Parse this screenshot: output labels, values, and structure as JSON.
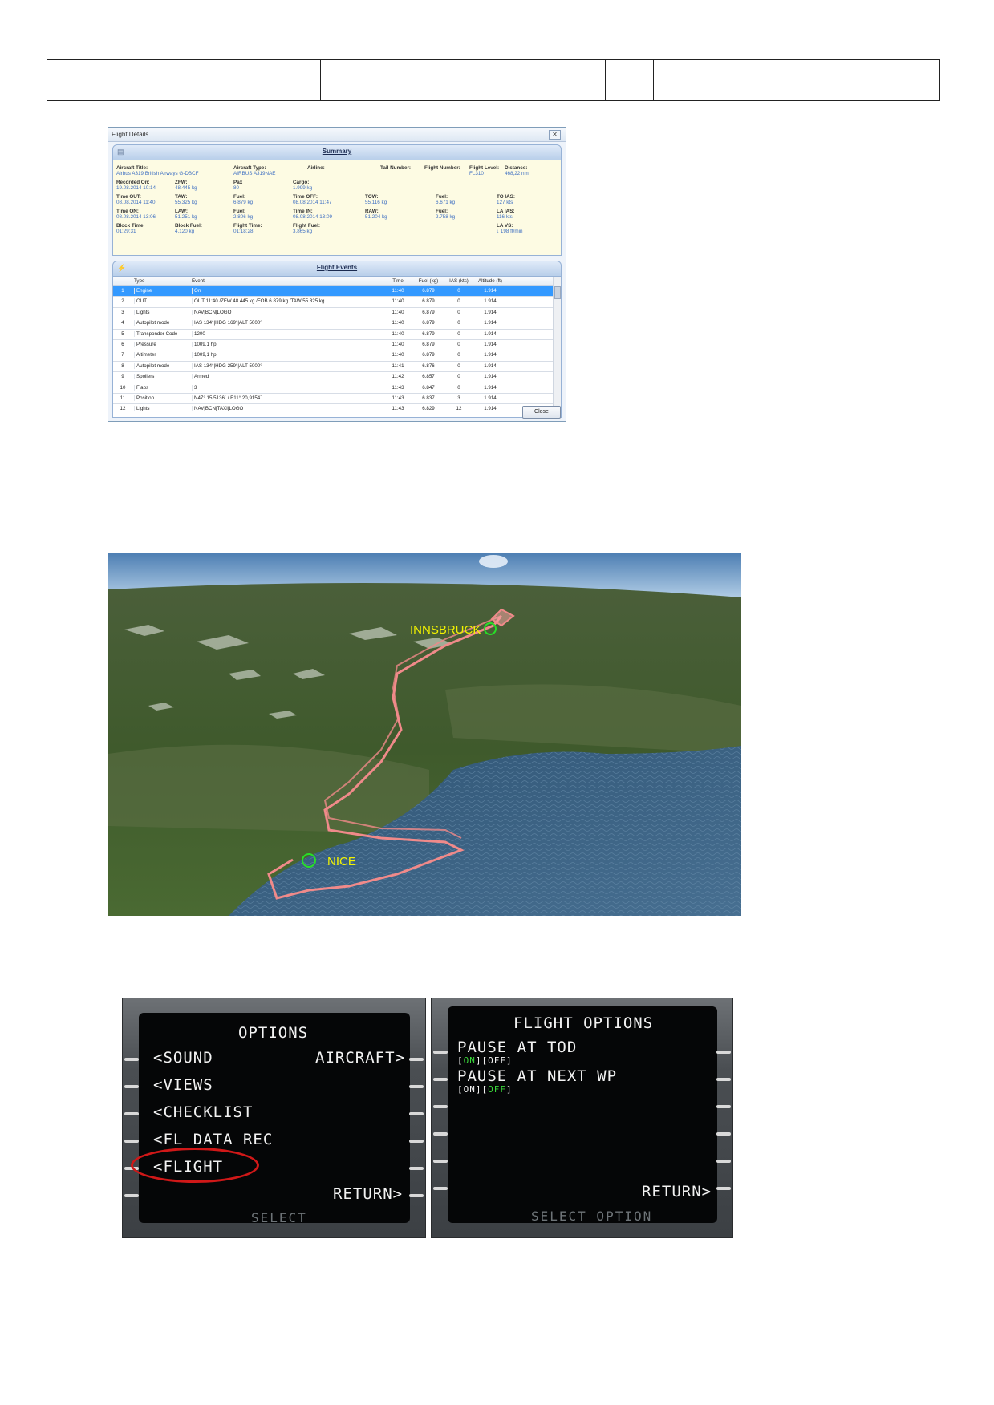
{
  "flight_details": {
    "window_title": "Flight Details",
    "summary_title": "Summary",
    "events_title": "Flight Events",
    "close_label": "Close",
    "summary": [
      {
        "label": "Aircraft Title:",
        "value": "Airbus A319 British Airways G-DBCF"
      },
      {
        "label": "Aircraft Type:",
        "value": "AIRBUS A319NAE"
      },
      {
        "label": "Airline:",
        "value": ""
      },
      {
        "label": "Tail Number:",
        "value": ""
      },
      {
        "label": "Flight Number:",
        "value": ""
      },
      {
        "label": "Flight Level:",
        "value": "FL310"
      },
      {
        "label": "Distance:",
        "value": "468,22 nm"
      },
      {
        "label": "Recorded On:",
        "value": "19.08.2014 10:14"
      },
      {
        "label": "ZFW:",
        "value": "48.445 kg"
      },
      {
        "label": "Pax",
        "value": "80"
      },
      {
        "label": "Cargo:",
        "value": "1.999 kg"
      },
      {
        "label": "Time OUT:",
        "value": "08.08.2014 11:40"
      },
      {
        "label": "TAW:",
        "value": "55.325 kg"
      },
      {
        "label": "Fuel:",
        "value": "6.879 kg"
      },
      {
        "label": "Time OFF:",
        "value": "08.08.2014 11:47"
      },
      {
        "label": "TOW:",
        "value": "55.116 kg"
      },
      {
        "label": "Fuel:",
        "value": "6.671 kg"
      },
      {
        "label": "TO IAS:",
        "value": "127 kts"
      },
      {
        "label": "Time ON:",
        "value": "08.08.2014 13:06"
      },
      {
        "label": "LAW:",
        "value": "51.251 kg"
      },
      {
        "label": "Fuel:",
        "value": "2.806 kg"
      },
      {
        "label": "Time IN:",
        "value": "08.08.2014 13:09"
      },
      {
        "label": "RAW:",
        "value": "51.204 kg"
      },
      {
        "label": "Fuel:",
        "value": "2.758 kg"
      },
      {
        "label": "LA IAS:",
        "value": "116 kts"
      },
      {
        "label": "Block Time:",
        "value": "01:29:31"
      },
      {
        "label": "Block Fuel:",
        "value": "4.120 kg"
      },
      {
        "label": "Flight Time:",
        "value": "01:18:28"
      },
      {
        "label": "Flight Fuel:",
        "value": "3.865 kg"
      },
      {
        "label": "LA VS:",
        "value": "↓ 198 ft/min"
      }
    ],
    "columns": [
      "",
      "Type",
      "Event",
      "Time",
      "Fuel (kg)",
      "IAS (kts)",
      "Altitude (ft)"
    ],
    "events": [
      {
        "n": "1",
        "type": "Engine",
        "event": "On",
        "time": "11:40",
        "fuel": "6.879",
        "ias": "0",
        "alt": "1.914"
      },
      {
        "n": "2",
        "type": "OUT",
        "event": "OUT 11:40 /ZFW 48.445 kg /FOB 6.879 kg /TAW 55.325 kg",
        "time": "11:40",
        "fuel": "6.879",
        "ias": "0",
        "alt": "1.914"
      },
      {
        "n": "3",
        "type": "Lights",
        "event": "NAV|BCN|LOGO",
        "time": "11:40",
        "fuel": "6.879",
        "ias": "0",
        "alt": "1.914"
      },
      {
        "n": "4",
        "type": "Autopilot mode",
        "event": "IAS 134°|HDG 169°|ALT 5000°",
        "time": "11:40",
        "fuel": "6.879",
        "ias": "0",
        "alt": "1.914"
      },
      {
        "n": "5",
        "type": "Transponder Code",
        "event": "1200",
        "time": "11:40",
        "fuel": "6.879",
        "ias": "0",
        "alt": "1.914"
      },
      {
        "n": "6",
        "type": "Pressure",
        "event": "1009,1 hp",
        "time": "11:40",
        "fuel": "6.879",
        "ias": "0",
        "alt": "1.914"
      },
      {
        "n": "7",
        "type": "Altimeter",
        "event": "1009,1 hp",
        "time": "11:40",
        "fuel": "6.879",
        "ias": "0",
        "alt": "1.914"
      },
      {
        "n": "8",
        "type": "Autopilot mode",
        "event": "IAS 134°|HDG 259°|ALT 5000°",
        "time": "11:41",
        "fuel": "6.876",
        "ias": "0",
        "alt": "1.914"
      },
      {
        "n": "9",
        "type": "Spoilers",
        "event": "Armed",
        "time": "11:42",
        "fuel": "6.857",
        "ias": "0",
        "alt": "1.914"
      },
      {
        "n": "10",
        "type": "Flaps",
        "event": "3",
        "time": "11:43",
        "fuel": "6.847",
        "ias": "0",
        "alt": "1.914"
      },
      {
        "n": "11",
        "type": "Position",
        "event": "N47° 15,5136´ / E11° 20,9154´",
        "time": "11:43",
        "fuel": "6.837",
        "ias": "3",
        "alt": "1.914"
      },
      {
        "n": "12",
        "type": "Lights",
        "event": "NAV|BCN|TAXI|LOGO",
        "time": "11:43",
        "fuel": "6.829",
        "ias": "12",
        "alt": "1.914"
      }
    ]
  },
  "map": {
    "label_innsbruck": "INNSBRUCK",
    "label_nice": "NICE",
    "track_color": "#f08a8a",
    "marker_color": "#27e027",
    "label_color": "#f2f200"
  },
  "mcdu_options": {
    "title": "OPTIONS",
    "sound": "<SOUND",
    "aircraft": "AIRCRAFT>",
    "views": "<VIEWS",
    "checklist": "<CHECKLIST",
    "fl_data_rec": "<FL DATA REC",
    "flight": "<FLIGHT",
    "return": "RETURN>",
    "footer": "SELECT"
  },
  "mcdu_flight_options": {
    "title": "FLIGHT OPTIONS",
    "pause_tod": "PAUSE AT TOD",
    "pause_tod_on": "ON",
    "pause_tod_off": "OFF",
    "pause_next_wp": "PAUSE AT NEXT WP",
    "pause_wp_on": "ON",
    "pause_wp_off": "OFF",
    "return": "RETURN>",
    "footer": "SELECT OPTION"
  }
}
